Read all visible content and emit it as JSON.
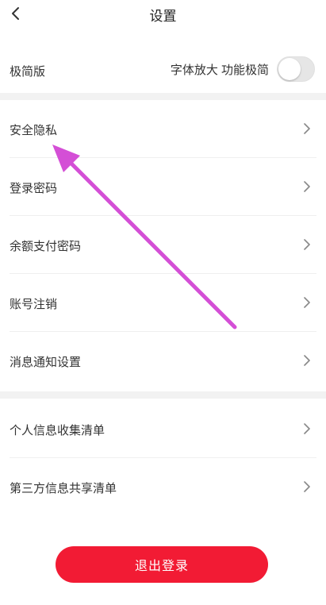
{
  "colors": {
    "accent": "#f21b34",
    "annotation_arrow": "#d44fd6"
  },
  "header": {
    "title": "设置",
    "back_icon": "chevron-left-icon"
  },
  "minimal_mode": {
    "label": "极简版",
    "hint": "字体放大 功能极简",
    "toggle_on": false
  },
  "group1": [
    {
      "label": "安全隐私"
    },
    {
      "label": "登录密码"
    },
    {
      "label": "余额支付密码"
    },
    {
      "label": "账号注销"
    },
    {
      "label": "消息通知设置"
    }
  ],
  "group2": [
    {
      "label": "个人信息收集清单"
    },
    {
      "label": "第三方信息共享清单"
    }
  ],
  "logout_label": "退出登录"
}
